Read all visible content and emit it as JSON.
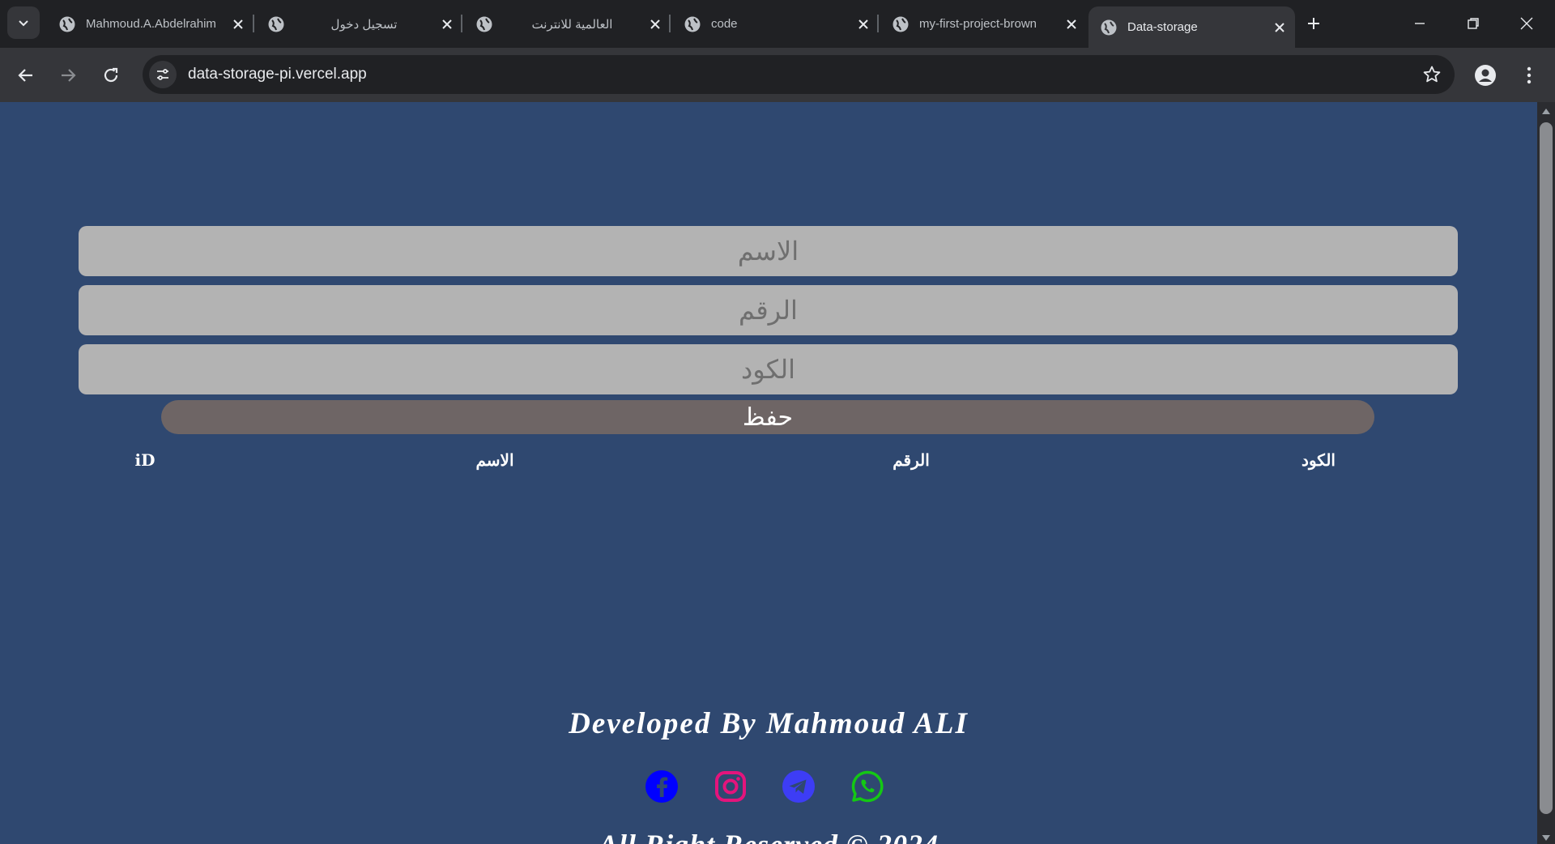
{
  "browser": {
    "tabs": [
      {
        "title": "Mahmoud.A.Abdelrahim",
        "rtl": false,
        "active": false
      },
      {
        "title": "تسجيل دخول",
        "rtl": true,
        "active": false
      },
      {
        "title": "العالمية للانترنت",
        "rtl": true,
        "active": false
      },
      {
        "title": "code",
        "rtl": false,
        "active": false
      },
      {
        "title": "my-first-project-brown",
        "rtl": false,
        "active": false
      },
      {
        "title": "Data-storage",
        "rtl": false,
        "active": true
      }
    ],
    "url": "data-storage-pi.vercel.app",
    "icons": {
      "tab_search": "chevron-down-icon",
      "new_tab": "plus-icon",
      "back": "arrow-left-icon",
      "forward": "arrow-right-icon",
      "reload": "reload-icon",
      "site_info": "tune-icon",
      "bookmark": "star-icon",
      "profile": "person-icon",
      "menu": "kebab-icon"
    }
  },
  "form": {
    "name_placeholder": "الاسم",
    "number_placeholder": "الرقم",
    "code_placeholder": "الكود",
    "save_label": "حفظ"
  },
  "table": {
    "headers": [
      "iD",
      "الاسم",
      "الرقم",
      "الكود"
    ],
    "rows": []
  },
  "footer": {
    "developer": "Developed By Mahmoud ALI",
    "social": [
      {
        "name": "facebook-icon",
        "color": "#0000ff"
      },
      {
        "name": "instagram-icon",
        "color": "#e4147c"
      },
      {
        "name": "telegram-icon",
        "color": "#3d3df5"
      },
      {
        "name": "whatsapp-icon",
        "color": "#14c814"
      }
    ],
    "rights": "All Right Reserved © 2024"
  },
  "colors": {
    "page_bg": "#2f4870",
    "field_bg": "#b3b3b3",
    "button_bg": "#6e6565"
  }
}
